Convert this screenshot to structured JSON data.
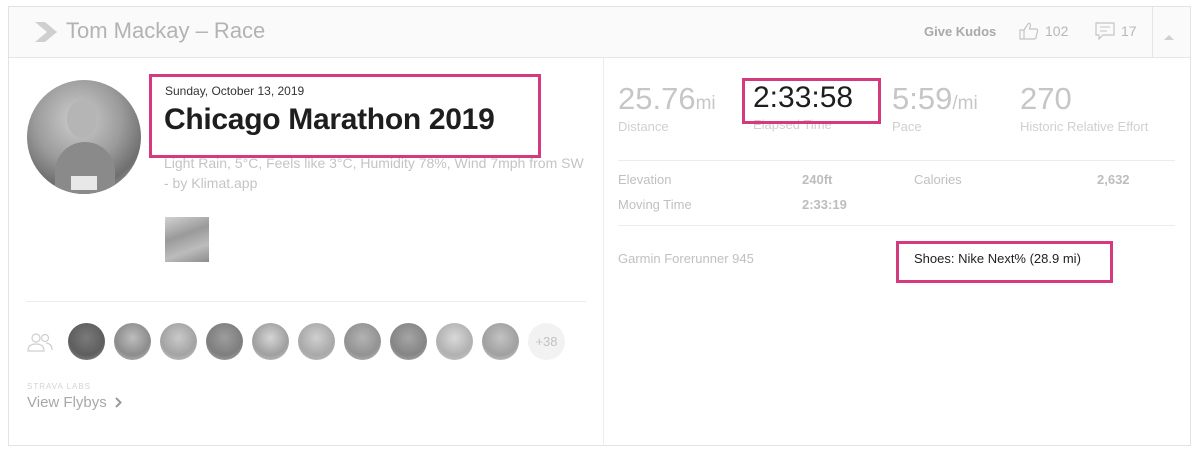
{
  "header": {
    "title": "Tom Mackay – Race",
    "give_kudos": "Give Kudos",
    "kudos_count": "102",
    "comment_count": "17"
  },
  "activity": {
    "date": "Sunday, October 13, 2019",
    "name": "Chicago Marathon 2019",
    "description": "Light Rain, 5°C, Feels like 3°C, Humidity 78%, Wind 7mph from SW - by Klimat.app"
  },
  "stats": {
    "distance_value": "25.76",
    "distance_unit": "mi",
    "distance_label": "Distance",
    "elapsed_value": "2:33:58",
    "elapsed_label": "Elapsed Time",
    "pace_value": "5:59",
    "pace_unit": "/mi",
    "pace_label": "Pace",
    "effort_value": "270",
    "effort_label": "Historic Relative Effort"
  },
  "more_stats": {
    "elevation_label": "Elevation",
    "elevation_value": "240ft",
    "calories_label": "Calories",
    "calories_value": "2,632",
    "moving_time_label": "Moving Time",
    "moving_time_value": "2:33:19"
  },
  "gear": {
    "device": "Garmin Forerunner 945",
    "shoes": "Shoes: Nike Next% (28.9 mi)"
  },
  "group": {
    "more_athletes": "+38",
    "labs_label": "STRAVA LABS",
    "flybys_link": "View Flybys"
  },
  "colors": {
    "highlight": "#d63a7e"
  }
}
